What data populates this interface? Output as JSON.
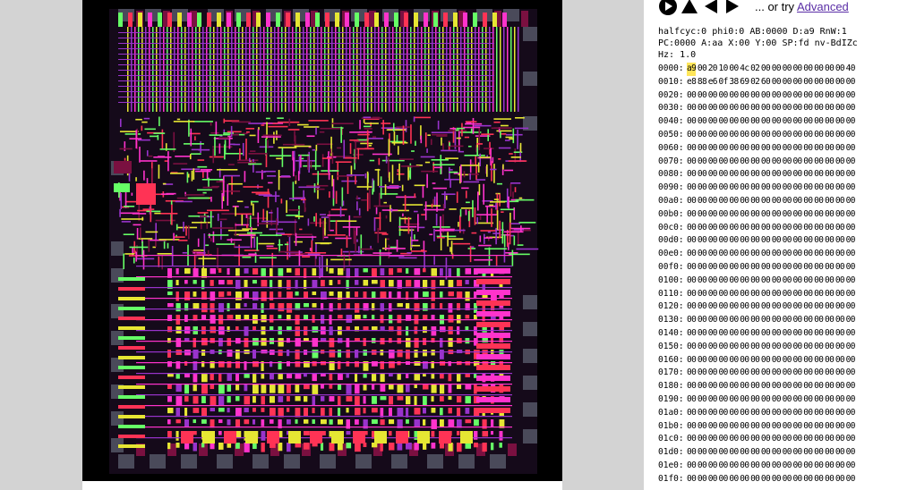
{
  "app": {
    "controls": [
      {
        "name": "run-pause-icon"
      },
      {
        "name": "step-up-icon"
      },
      {
        "name": "step-back-icon"
      },
      {
        "name": "step-forward-icon"
      }
    ],
    "try_prefix": "... or try ",
    "try_link": "Advanced"
  },
  "status": {
    "line1": "halfcyc:0 phi0:0 AB:0000 D:a9 RnW:1",
    "line2": "PC:0000 A:aa X:00 Y:00 SP:fd nv-BdIZc",
    "line3": "Hz: 1.0"
  },
  "memory": {
    "highlight": {
      "row": 0,
      "col": 0
    },
    "rows": [
      {
        "addr": "0000:",
        "bytes": [
          "a9",
          "00",
          "20",
          "10",
          "00",
          "4c",
          "02",
          "00",
          "00",
          "00",
          "00",
          "00",
          "00",
          "00",
          "00",
          "40"
        ]
      },
      {
        "addr": "0010:",
        "bytes": [
          "e8",
          "88",
          "e6",
          "0f",
          "38",
          "69",
          "02",
          "60",
          "00",
          "00",
          "00",
          "00",
          "00",
          "00",
          "00",
          "00"
        ]
      },
      {
        "addr": "0020:",
        "bytes": [
          "00",
          "00",
          "00",
          "00",
          "00",
          "00",
          "00",
          "00",
          "00",
          "00",
          "00",
          "00",
          "00",
          "00",
          "00",
          "00"
        ]
      },
      {
        "addr": "0030:",
        "bytes": [
          "00",
          "00",
          "00",
          "00",
          "00",
          "00",
          "00",
          "00",
          "00",
          "00",
          "00",
          "00",
          "00",
          "00",
          "00",
          "00"
        ]
      },
      {
        "addr": "0040:",
        "bytes": [
          "00",
          "00",
          "00",
          "00",
          "00",
          "00",
          "00",
          "00",
          "00",
          "00",
          "00",
          "00",
          "00",
          "00",
          "00",
          "00"
        ]
      },
      {
        "addr": "0050:",
        "bytes": [
          "00",
          "00",
          "00",
          "00",
          "00",
          "00",
          "00",
          "00",
          "00",
          "00",
          "00",
          "00",
          "00",
          "00",
          "00",
          "00"
        ]
      },
      {
        "addr": "0060:",
        "bytes": [
          "00",
          "00",
          "00",
          "00",
          "00",
          "00",
          "00",
          "00",
          "00",
          "00",
          "00",
          "00",
          "00",
          "00",
          "00",
          "00"
        ]
      },
      {
        "addr": "0070:",
        "bytes": [
          "00",
          "00",
          "00",
          "00",
          "00",
          "00",
          "00",
          "00",
          "00",
          "00",
          "00",
          "00",
          "00",
          "00",
          "00",
          "00"
        ]
      },
      {
        "addr": "0080:",
        "bytes": [
          "00",
          "00",
          "00",
          "00",
          "00",
          "00",
          "00",
          "00",
          "00",
          "00",
          "00",
          "00",
          "00",
          "00",
          "00",
          "00"
        ]
      },
      {
        "addr": "0090:",
        "bytes": [
          "00",
          "00",
          "00",
          "00",
          "00",
          "00",
          "00",
          "00",
          "00",
          "00",
          "00",
          "00",
          "00",
          "00",
          "00",
          "00"
        ]
      },
      {
        "addr": "00a0:",
        "bytes": [
          "00",
          "00",
          "00",
          "00",
          "00",
          "00",
          "00",
          "00",
          "00",
          "00",
          "00",
          "00",
          "00",
          "00",
          "00",
          "00"
        ]
      },
      {
        "addr": "00b0:",
        "bytes": [
          "00",
          "00",
          "00",
          "00",
          "00",
          "00",
          "00",
          "00",
          "00",
          "00",
          "00",
          "00",
          "00",
          "00",
          "00",
          "00"
        ]
      },
      {
        "addr": "00c0:",
        "bytes": [
          "00",
          "00",
          "00",
          "00",
          "00",
          "00",
          "00",
          "00",
          "00",
          "00",
          "00",
          "00",
          "00",
          "00",
          "00",
          "00"
        ]
      },
      {
        "addr": "00d0:",
        "bytes": [
          "00",
          "00",
          "00",
          "00",
          "00",
          "00",
          "00",
          "00",
          "00",
          "00",
          "00",
          "00",
          "00",
          "00",
          "00",
          "00"
        ]
      },
      {
        "addr": "00e0:",
        "bytes": [
          "00",
          "00",
          "00",
          "00",
          "00",
          "00",
          "00",
          "00",
          "00",
          "00",
          "00",
          "00",
          "00",
          "00",
          "00",
          "00"
        ]
      },
      {
        "addr": "00f0:",
        "bytes": [
          "00",
          "00",
          "00",
          "00",
          "00",
          "00",
          "00",
          "00",
          "00",
          "00",
          "00",
          "00",
          "00",
          "00",
          "00",
          "00"
        ]
      },
      {
        "addr": "0100:",
        "bytes": [
          "00",
          "00",
          "00",
          "00",
          "00",
          "00",
          "00",
          "00",
          "00",
          "00",
          "00",
          "00",
          "00",
          "00",
          "00",
          "00"
        ]
      },
      {
        "addr": "0110:",
        "bytes": [
          "00",
          "00",
          "00",
          "00",
          "00",
          "00",
          "00",
          "00",
          "00",
          "00",
          "00",
          "00",
          "00",
          "00",
          "00",
          "00"
        ]
      },
      {
        "addr": "0120:",
        "bytes": [
          "00",
          "00",
          "00",
          "00",
          "00",
          "00",
          "00",
          "00",
          "00",
          "00",
          "00",
          "00",
          "00",
          "00",
          "00",
          "00"
        ]
      },
      {
        "addr": "0130:",
        "bytes": [
          "00",
          "00",
          "00",
          "00",
          "00",
          "00",
          "00",
          "00",
          "00",
          "00",
          "00",
          "00",
          "00",
          "00",
          "00",
          "00"
        ]
      },
      {
        "addr": "0140:",
        "bytes": [
          "00",
          "00",
          "00",
          "00",
          "00",
          "00",
          "00",
          "00",
          "00",
          "00",
          "00",
          "00",
          "00",
          "00",
          "00",
          "00"
        ]
      },
      {
        "addr": "0150:",
        "bytes": [
          "00",
          "00",
          "00",
          "00",
          "00",
          "00",
          "00",
          "00",
          "00",
          "00",
          "00",
          "00",
          "00",
          "00",
          "00",
          "00"
        ]
      },
      {
        "addr": "0160:",
        "bytes": [
          "00",
          "00",
          "00",
          "00",
          "00",
          "00",
          "00",
          "00",
          "00",
          "00",
          "00",
          "00",
          "00",
          "00",
          "00",
          "00"
        ]
      },
      {
        "addr": "0170:",
        "bytes": [
          "00",
          "00",
          "00",
          "00",
          "00",
          "00",
          "00",
          "00",
          "00",
          "00",
          "00",
          "00",
          "00",
          "00",
          "00",
          "00"
        ]
      },
      {
        "addr": "0180:",
        "bytes": [
          "00",
          "00",
          "00",
          "00",
          "00",
          "00",
          "00",
          "00",
          "00",
          "00",
          "00",
          "00",
          "00",
          "00",
          "00",
          "00"
        ]
      },
      {
        "addr": "0190:",
        "bytes": [
          "00",
          "00",
          "00",
          "00",
          "00",
          "00",
          "00",
          "00",
          "00",
          "00",
          "00",
          "00",
          "00",
          "00",
          "00",
          "00"
        ]
      },
      {
        "addr": "01a0:",
        "bytes": [
          "00",
          "00",
          "00",
          "00",
          "00",
          "00",
          "00",
          "00",
          "00",
          "00",
          "00",
          "00",
          "00",
          "00",
          "00",
          "00"
        ]
      },
      {
        "addr": "01b0:",
        "bytes": [
          "00",
          "00",
          "00",
          "00",
          "00",
          "00",
          "00",
          "00",
          "00",
          "00",
          "00",
          "00",
          "00",
          "00",
          "00",
          "00"
        ]
      },
      {
        "addr": "01c0:",
        "bytes": [
          "00",
          "00",
          "00",
          "00",
          "00",
          "00",
          "00",
          "00",
          "00",
          "00",
          "00",
          "00",
          "00",
          "00",
          "00",
          "00"
        ]
      },
      {
        "addr": "01d0:",
        "bytes": [
          "00",
          "00",
          "00",
          "00",
          "00",
          "00",
          "00",
          "00",
          "00",
          "00",
          "00",
          "00",
          "00",
          "00",
          "00",
          "00"
        ]
      },
      {
        "addr": "01e0:",
        "bytes": [
          "00",
          "00",
          "00",
          "00",
          "00",
          "00",
          "00",
          "00",
          "00",
          "00",
          "00",
          "00",
          "00",
          "00",
          "00",
          "00"
        ]
      },
      {
        "addr": "01f0:",
        "bytes": [
          "00",
          "00",
          "00",
          "00",
          "00",
          "00",
          "00",
          "00",
          "00",
          "00",
          "00",
          "00",
          "00",
          "00",
          "00",
          "00"
        ]
      }
    ]
  },
  "colors": {
    "panel_bg": "#000000",
    "page_gray": "#d3d3d3",
    "layer_magenta": "#ff33cc",
    "layer_purple": "#9933cc",
    "layer_red": "#ff3355",
    "layer_yellow": "#e6e633",
    "layer_green": "#66ff66",
    "layer_maroon": "#7a1040",
    "pad_gray": "#4a4a5a",
    "highlight": "#ffe65a",
    "link": "#5a2ea6"
  }
}
